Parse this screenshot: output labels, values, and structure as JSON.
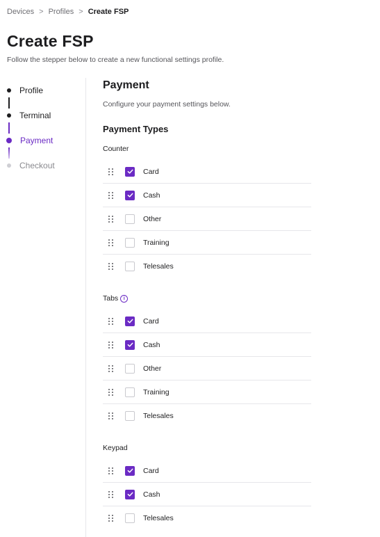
{
  "breadcrumb": {
    "items": [
      "Devices",
      "Profiles",
      "Create FSP"
    ],
    "separator": ">"
  },
  "page": {
    "title": "Create FSP",
    "subtitle": "Follow the stepper below to create a new functional settings profile."
  },
  "stepper": {
    "steps": [
      {
        "label": "Profile",
        "state": "complete"
      },
      {
        "label": "Terminal",
        "state": "complete"
      },
      {
        "label": "Payment",
        "state": "active"
      },
      {
        "label": "Checkout",
        "state": "pending"
      }
    ]
  },
  "payment": {
    "title": "Payment",
    "subtitle": "Configure your payment settings below.",
    "types_title": "Payment Types",
    "groups": [
      {
        "label": "Counter",
        "info_icon": false,
        "items": [
          {
            "label": "Card",
            "checked": true
          },
          {
            "label": "Cash",
            "checked": true
          },
          {
            "label": "Other",
            "checked": false
          },
          {
            "label": "Training",
            "checked": false
          },
          {
            "label": "Telesales",
            "checked": false
          }
        ]
      },
      {
        "label": "Tabs",
        "info_icon": true,
        "info_icon_name": "info-icon",
        "items": [
          {
            "label": "Card",
            "checked": true
          },
          {
            "label": "Cash",
            "checked": true
          },
          {
            "label": "Other",
            "checked": false
          },
          {
            "label": "Training",
            "checked": false
          },
          {
            "label": "Telesales",
            "checked": false
          }
        ]
      },
      {
        "label": "Keypad",
        "info_icon": false,
        "items": [
          {
            "label": "Card",
            "checked": true
          },
          {
            "label": "Cash",
            "checked": true
          },
          {
            "label": "Telesales",
            "checked": false
          }
        ]
      }
    ]
  },
  "colors": {
    "accent": "#6b2bc4",
    "text": "#1d1d1f",
    "muted": "#8a8a8f",
    "divider": "#e6e6ea"
  }
}
